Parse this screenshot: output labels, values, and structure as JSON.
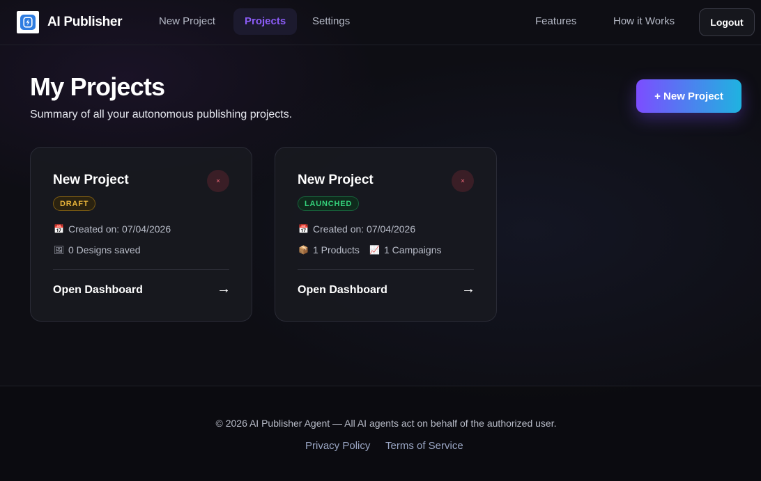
{
  "nav": {
    "brand": "AI Publisher",
    "links": [
      "New Project",
      "Projects",
      "Settings",
      "Features",
      "How it Works"
    ],
    "logout": "Logout"
  },
  "header": {
    "title": "My Projects",
    "subtitle": "Summary of all your autonomous publishing projects.",
    "new_button": "+ New Project"
  },
  "cards": [
    {
      "name": "New Project",
      "status": "DRAFT",
      "created": "Created on: 07/04/2026",
      "stats": [
        "0 Designs saved"
      ],
      "open": "Open Dashboard",
      "arrow": "→",
      "delete": "×"
    },
    {
      "name": "New Project",
      "status": "LAUNCHED",
      "created": "Created on: 07/04/2026",
      "stats": [
        "1 Products",
        "1 Campaigns"
      ],
      "open": "Open Dashboard",
      "arrow": "→",
      "delete": "×"
    }
  ],
  "footer": {
    "copyright": "© 2026 AI Publisher Agent — All AI agents act on behalf of the authorized user.",
    "privacy": "Privacy Policy",
    "terms": "Terms of Service"
  },
  "colors": {
    "accent": "#8b5cf6",
    "gradient_start": "#7c4dff",
    "gradient_end": "#1fb3e0",
    "draft": "#e8b43a",
    "launched": "#34d27b",
    "delete": "#f26b7a"
  },
  "icons": [
    "calendar-icon",
    "image-icon",
    "package-icon",
    "chart-icon",
    "close-icon",
    "arrow-right-icon",
    "lightning-icon"
  ]
}
